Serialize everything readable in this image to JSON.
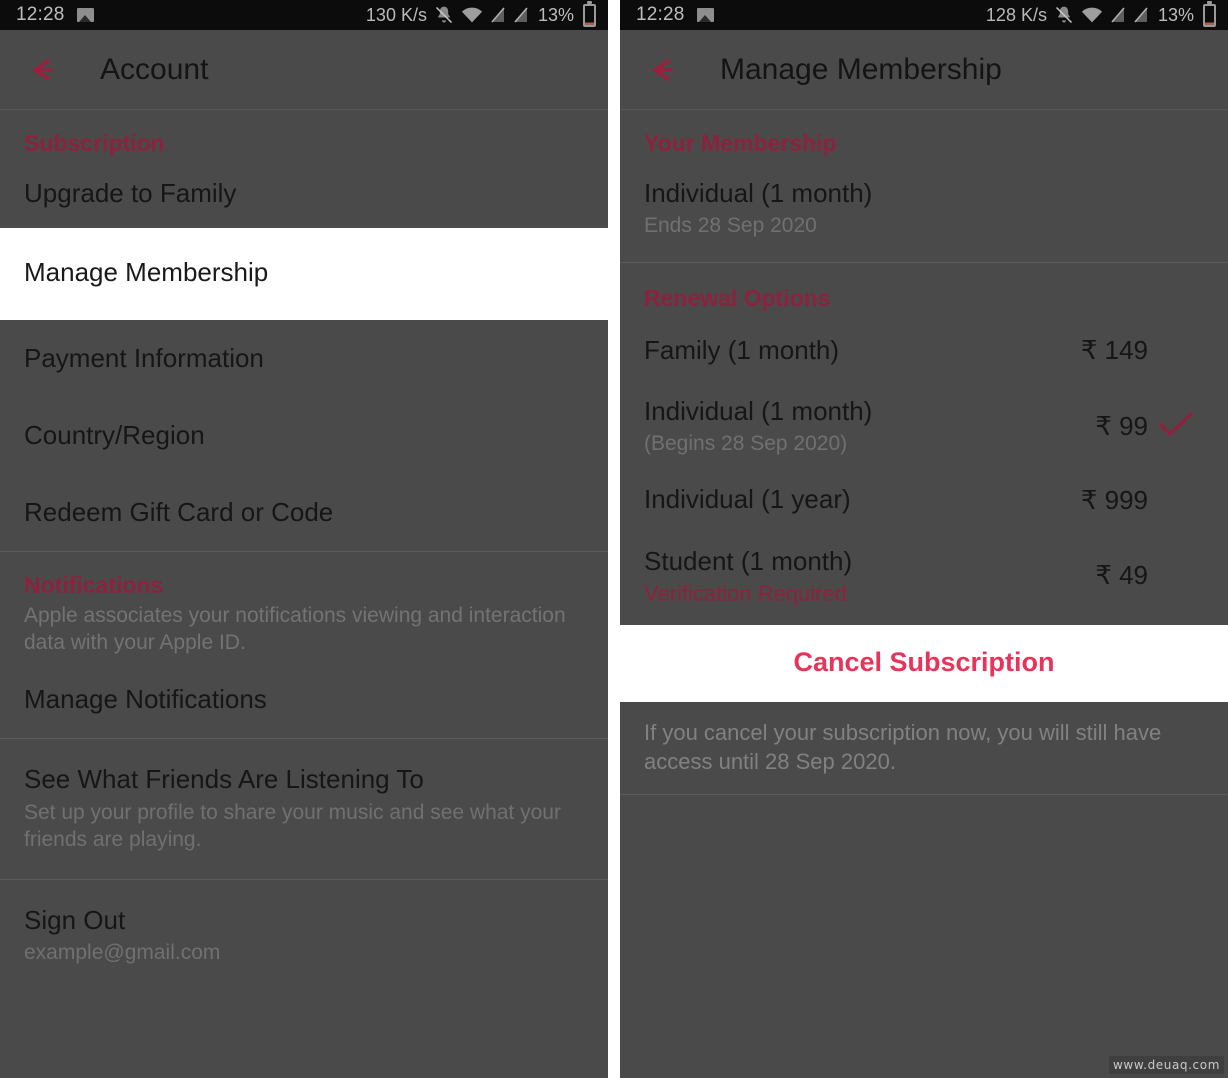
{
  "status_bar_left": {
    "time": "12:28",
    "network_speed": "130 K/s",
    "battery_percent": "13%",
    "icons": [
      "image-icon",
      "bell-muted-icon",
      "wifi-icon",
      "sim1-no-signal-icon",
      "sim2-no-signal-icon",
      "battery-icon"
    ]
  },
  "status_bar_right": {
    "time": "12:28",
    "network_speed": "128 K/s",
    "battery_percent": "13%",
    "icons": [
      "image-icon",
      "bell-muted-icon",
      "wifi-icon",
      "sim1-no-signal-icon",
      "sim2-no-signal-icon",
      "battery-icon"
    ]
  },
  "colors": {
    "accent_pink": "#e8345a",
    "accent_pink_dimmed": "#8d2240",
    "screen_background": "#4a4a4a",
    "highlight_background": "#ffffff",
    "status_bar_background": "#0c0c0c"
  },
  "left_screen": {
    "app_bar": {
      "title": "Account",
      "back_icon": "arrow-left-icon"
    },
    "sections": [
      {
        "header": "Subscription",
        "items": [
          {
            "title": "Upgrade to Family",
            "highlighted": false
          }
        ]
      },
      {
        "header": null,
        "items": [
          {
            "title": "Manage Membership",
            "highlighted": true
          }
        ]
      },
      {
        "header": null,
        "items": [
          {
            "title": "Payment Information",
            "highlighted": false
          },
          {
            "title": "Country/Region",
            "highlighted": false
          },
          {
            "title": "Redeem Gift Card or Code",
            "highlighted": false
          }
        ]
      },
      {
        "header": "Notifications",
        "header_description": "Apple associates your notifications viewing and interaction data with your Apple ID.",
        "items": [
          {
            "title": "Manage Notifications",
            "highlighted": false
          }
        ]
      },
      {
        "header": null,
        "items": [
          {
            "title": "See What Friends Are Listening To",
            "subtitle": "Set up your profile to share your music and see what your friends are playing.",
            "highlighted": false
          }
        ]
      },
      {
        "header": null,
        "items": [
          {
            "title": "Sign Out",
            "subtitle": "example@gmail.com",
            "highlighted": false
          }
        ]
      }
    ]
  },
  "right_screen": {
    "app_bar": {
      "title": "Manage Membership",
      "back_icon": "arrow-left-icon"
    },
    "your_membership": {
      "header": "Your Membership",
      "plan": "Individual (1 month)",
      "ends": "Ends 28 Sep 2020"
    },
    "renewal_options": {
      "header": "Renewal Options",
      "options": [
        {
          "title": "Family (1 month)",
          "price": "₹ 149",
          "selected": false
        },
        {
          "title": "Individual (1 month)",
          "note": "(Begins 28 Sep 2020)",
          "price": "₹ 99",
          "selected": true
        },
        {
          "title": "Individual (1 year)",
          "price": "₹ 999",
          "selected": false
        },
        {
          "title": "Student (1 month)",
          "verification": "Verification Required",
          "price": "₹ 49",
          "selected": false
        }
      ]
    },
    "cancel": {
      "label": "Cancel Subscription",
      "note": "If you cancel your subscription now, you will still have access until 28 Sep 2020."
    }
  },
  "watermark": "www.deuaq.com"
}
